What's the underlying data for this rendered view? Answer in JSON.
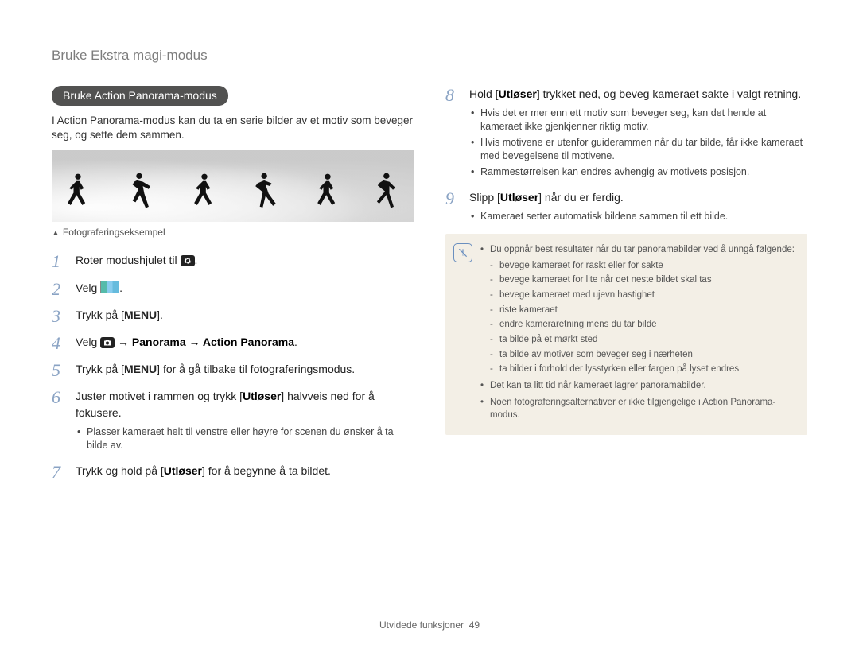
{
  "breadcrumb": "Bruke Ekstra magi-modus",
  "section_title": "Bruke Action Panorama-modus",
  "intro": "I Action Panorama-modus kan du ta en serie bilder av et motiv som beveger seg, og sette dem sammen.",
  "caption_marker": "▲",
  "caption": "Fotograferingseksempel",
  "steps_left": [
    {
      "n": "1",
      "pre": "Roter modushjulet til ",
      "icon": "gear",
      "post": "."
    },
    {
      "n": "2",
      "pre": "Velg ",
      "icon": "thumb",
      "post": "."
    },
    {
      "n": "3",
      "pre": "Trykk på [",
      "menu": "MENU",
      "post": "]."
    },
    {
      "n": "4",
      "pre": "Velg ",
      "icon": "camera",
      "bold_after": " → Panorama → Action Panorama",
      "post": "."
    },
    {
      "n": "5",
      "pre": "Trykk på [",
      "menu": "MENU",
      "post_plain": "] for å gå tilbake til fotograferingsmodus."
    },
    {
      "n": "6",
      "pre": "Juster motivet i rammen og trykk [",
      "bold_inline": "Utløser",
      "post_plain": "] halvveis ned for å fokusere.",
      "sub": [
        "Plasser kameraet helt til venstre eller høyre for scenen du ønsker å ta bilde av."
      ]
    },
    {
      "n": "7",
      "pre": "Trykk og hold på [",
      "bold_inline": "Utløser",
      "post_plain": "] for å begynne å ta bildet."
    }
  ],
  "steps_right": [
    {
      "n": "8",
      "pre": "Hold [",
      "bold_inline": "Utløser",
      "post_plain": "] trykket ned, og beveg kameraet sakte i valgt retning.",
      "sub": [
        "Hvis det er mer enn ett motiv som beveger seg, kan det hende at kameraet ikke gjenkjenner riktig motiv.",
        "Hvis motivene er utenfor guiderammen når du tar bilde, får ikke kameraet med bevegelsene til motivene.",
        "Rammestørrelsen kan endres avhengig av motivets posisjon."
      ]
    },
    {
      "n": "9",
      "pre": "Slipp [",
      "bold_inline": "Utløser",
      "post_plain": "] når du er ferdig.",
      "sub": [
        "Kameraet setter automatisk bildene sammen til ett bilde."
      ]
    }
  ],
  "note": {
    "lead": "Du oppnår best resultater når du tar panoramabilder ved å unngå følgende:",
    "inner": [
      "bevege kameraet for raskt eller for sakte",
      "bevege kameraet for lite når det neste bildet skal tas",
      "bevege kameraet med ujevn hastighet",
      "riste kameraet",
      "endre kameraretning mens du tar bilde",
      "ta bilde på et mørkt sted",
      "ta bilde av motiver som beveger seg i nærheten",
      "ta bilder i forhold der lysstyrken eller fargen på lyset endres"
    ],
    "tail": [
      "Det kan ta litt tid når kameraet lagrer panoramabilder.",
      "Noen fotograferingsalternativer er ikke tilgjengelige i Action Panorama-modus."
    ]
  },
  "footer_label": "Utvidede funksjoner",
  "footer_page": "49"
}
